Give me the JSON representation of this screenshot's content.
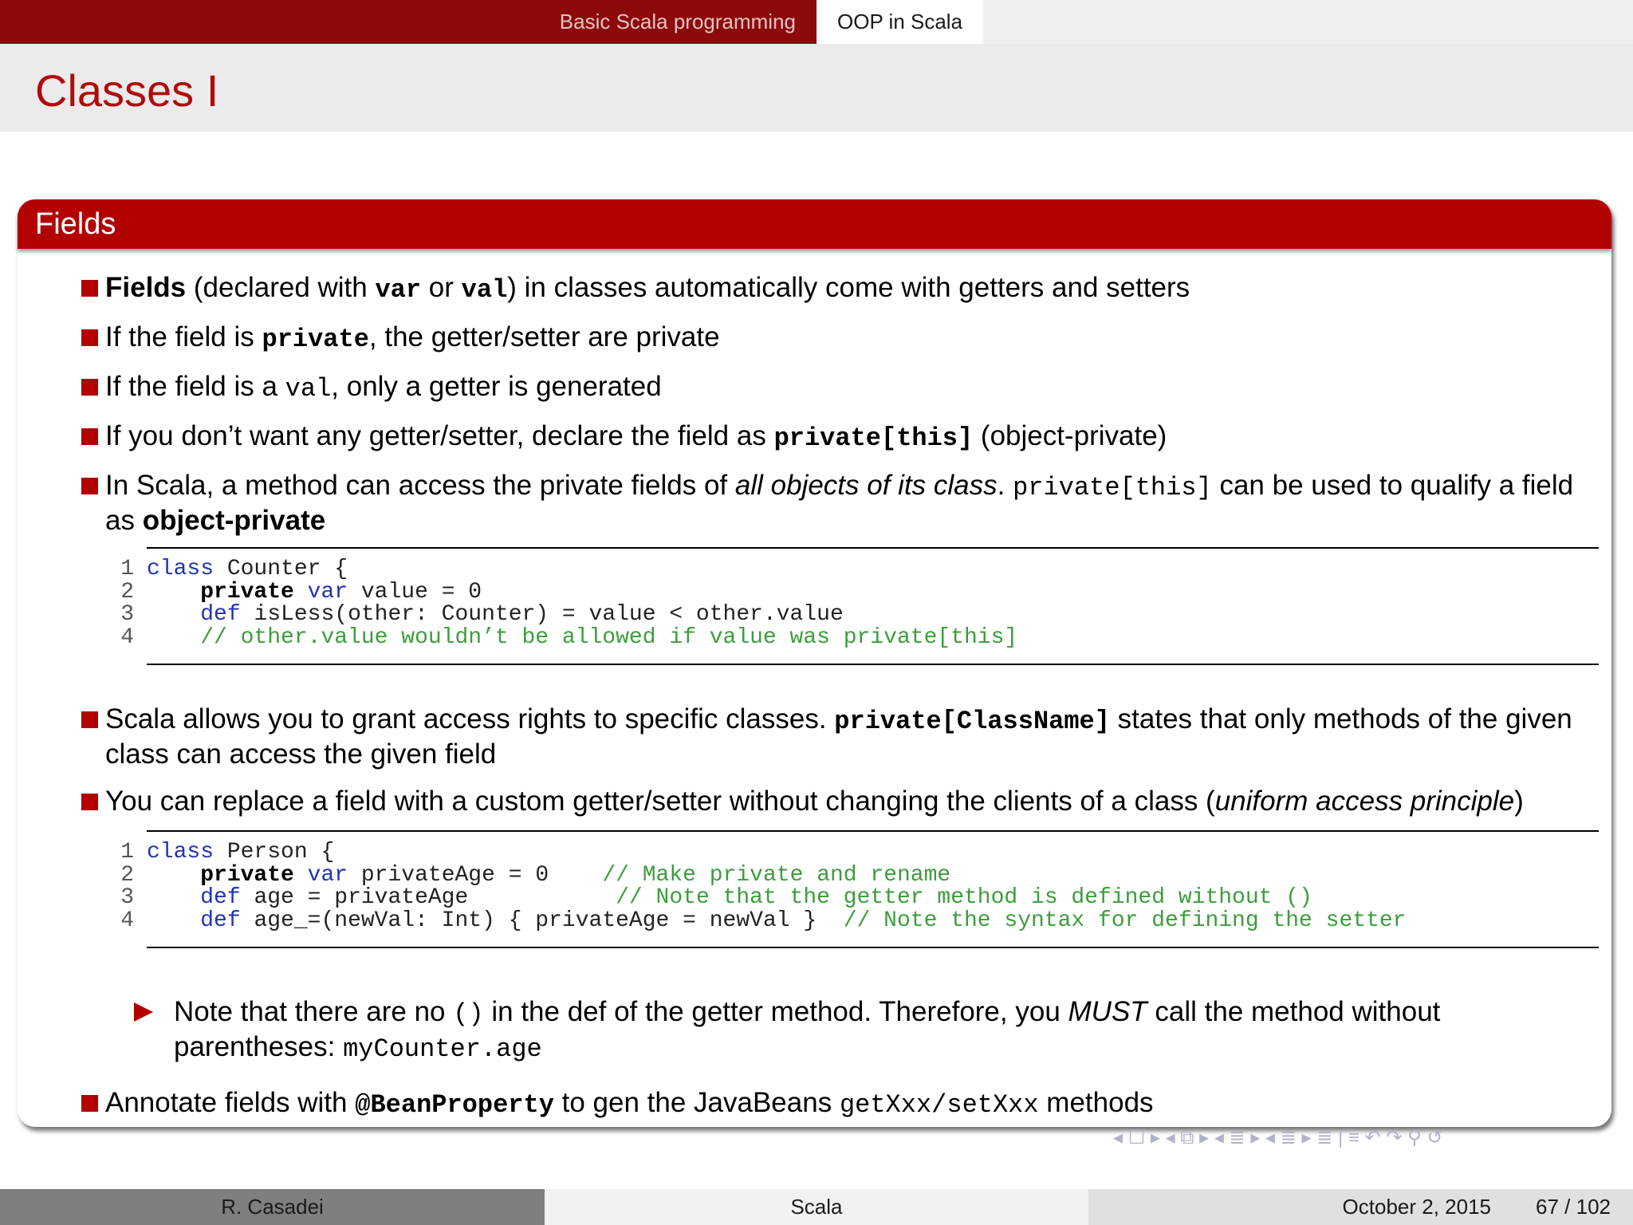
{
  "nav": {
    "section_1": "Basic Scala programming",
    "section_2": "OOP in Scala"
  },
  "frame_title": "Classes I",
  "block": {
    "title": "Fields",
    "items": [
      {
        "bold": "Fields",
        "t1": " (declared with ",
        "c1": "var",
        "t2": " or ",
        "c2": "val",
        "t3": ") in classes automatically come with getters and setters"
      },
      {
        "t1": "If the field is ",
        "c1": "private",
        "t2": ", the getter/setter are private"
      },
      {
        "t1": "If the field is a ",
        "c1": "val",
        "t2": ", only a getter is generated"
      },
      {
        "t1": "If you don’t want any getter/setter, declare the field as ",
        "c1": "private[this]",
        "t2": " (object-private)"
      },
      {
        "t1": "In Scala, a method can access the private fields of ",
        "i1": "all objects of its class",
        "t2": ". ",
        "c1": "private[this]",
        "t3": " can be used to qualify a field as ",
        "bold": "object-private"
      },
      {
        "t1": "Scala allows you to grant access rights to specific classes. ",
        "c1": "private[ClassName]",
        "t2": " states that only methods of the given class can access the given field"
      },
      {
        "t1": "You can replace a field with a custom getter/setter without changing the clients of a class (",
        "i1": "uniform access principle",
        "t2": ")"
      },
      {
        "t1": "Annotate fields with ",
        "c1": "@BeanProperty",
        "t2": " to gen the JavaBeans ",
        "c2": "getXxx/setXxx",
        "t3": " methods"
      }
    ],
    "subitem": {
      "t1": "Note that there are no ",
      "c1": "()",
      "t2": " in the def of the getter method. Therefore, you ",
      "i1": "MUST",
      "t3": " call the method without parentheses: ",
      "c2": "myCounter.age"
    },
    "listing_1": {
      "line_numbers": [
        "1",
        "2",
        "3",
        "4"
      ],
      "l1": {
        "kw": "class",
        "rest": " Counter {"
      },
      "l2": {
        "kb": "private",
        "kw": "var",
        "rest": " value = 0"
      },
      "l3": {
        "kw": "def",
        "rest": " isLess(other: Counter) = value < other.value"
      },
      "l4": {
        "cm": "// other.value wouldn’t be allowed if value was private[this]"
      }
    },
    "listing_2": {
      "line_numbers": [
        "1",
        "2",
        "3",
        "4"
      ],
      "l1": {
        "kw": "class",
        "rest": " Person {"
      },
      "l2": {
        "kb": "private",
        "kw": "var",
        "rest": " privateAge = 0    ",
        "cm": "// Make private and rename"
      },
      "l3": {
        "kw": "def",
        "rest": " age = privateAge           ",
        "cm": "// Note that the getter method is defined without ()"
      },
      "l4": {
        "kw": "def",
        "rest": " age_=(newVal: Int) { privateAge = newVal }  ",
        "cm": "// Note the syntax for defining the setter"
      }
    }
  },
  "nav_symbols": "◂ ☐ ▸ ◂ ⧉ ▸ ◂ ≣ ▸ ◂ ≣ ▸ ≣ | ≡ ↶ ↷ ⚲ ↺",
  "footer": {
    "author": "R. Casadei",
    "title": "Scala",
    "date": "October 2, 2015",
    "page": "67 / 102"
  }
}
